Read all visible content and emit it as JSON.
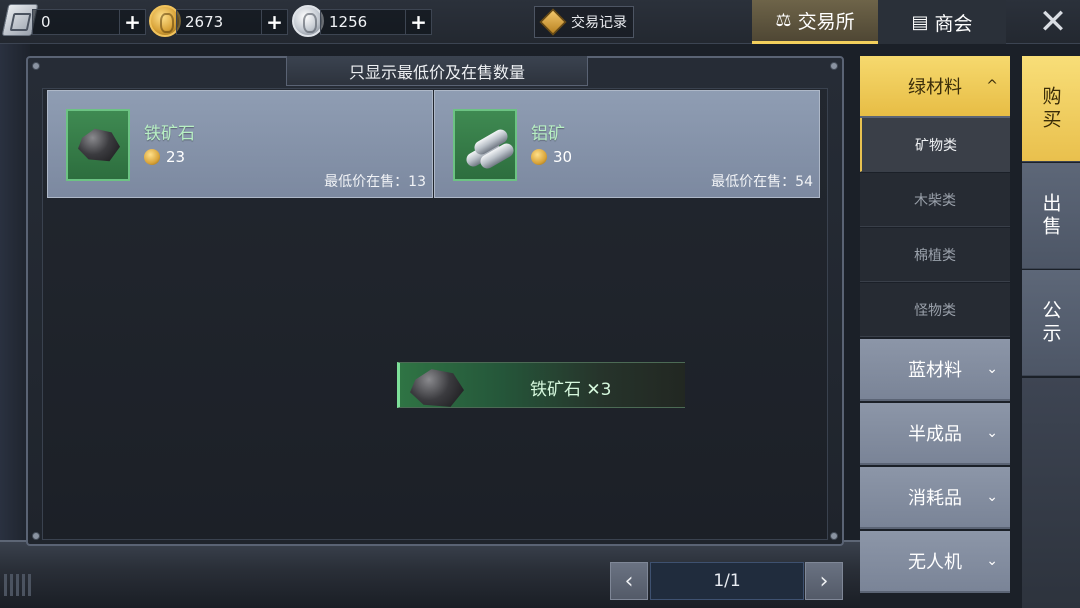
{
  "topbar": {
    "currencies": [
      {
        "name": "ticket",
        "value": "0",
        "plus": "+"
      },
      {
        "name": "gold",
        "value": "2673",
        "plus": "+"
      },
      {
        "name": "silver",
        "value": "1256",
        "plus": "+"
      }
    ],
    "trade_record_label": "交易记录",
    "tabs": [
      {
        "label": "交易所",
        "icon": "scale-icon",
        "active": true
      },
      {
        "label": "商会",
        "icon": "shop-icon",
        "active": false
      }
    ],
    "close_label": "✕"
  },
  "panel": {
    "header": "只显示最低价及在售数量",
    "items": [
      {
        "name": "铁矿石",
        "price": "23",
        "stock_label": "最低价在售：13",
        "icon": "iron-ore-icon"
      },
      {
        "name": "铝矿",
        "price": "30",
        "stock_label": "最低价在售：54",
        "icon": "aluminum-pipe-icon"
      }
    ]
  },
  "toast": {
    "text": "铁矿石 ✕3"
  },
  "pagination": {
    "prev": "‹",
    "indicator": "1/1",
    "next": "›"
  },
  "categories": {
    "groups": [
      {
        "label": "绿材料",
        "expanded": true,
        "chevron": "^"
      },
      {
        "label": "蓝材料",
        "expanded": false,
        "chevron": "⌄"
      },
      {
        "label": "半成品",
        "expanded": false,
        "chevron": "⌄"
      },
      {
        "label": "消耗品",
        "expanded": false,
        "chevron": "⌄"
      },
      {
        "label": "无人机",
        "expanded": false,
        "chevron": "⌄"
      }
    ],
    "subitems": [
      {
        "label": "矿物类",
        "active": true
      },
      {
        "label": "木柴类",
        "active": false
      },
      {
        "label": "棉植类",
        "active": false
      },
      {
        "label": "怪物类",
        "active": false
      }
    ]
  },
  "side_tabs": [
    {
      "label": "购买",
      "active": true
    },
    {
      "label": "出售",
      "active": false
    },
    {
      "label": "公示",
      "active": false
    }
  ],
  "colors": {
    "accent_gold": "#f3cf5c",
    "item_green": "#b8f0c4",
    "card_bg": "#8f9db3"
  }
}
